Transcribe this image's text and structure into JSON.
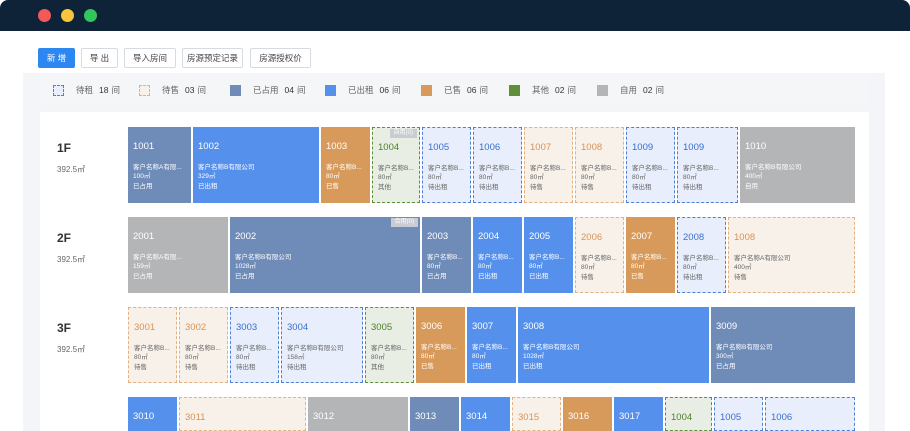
{
  "toolbar": {
    "buttons": [
      "新 增",
      "导 出",
      "导入房间",
      "房源预定记录",
      "房源授权价"
    ]
  },
  "colors": {
    "occupied": "#6f8bb7",
    "rented": "#5590ec",
    "sold": "#d89a5a",
    "other": "#5f8f3a",
    "self_use": "#b4b5b7",
    "wait_rent": "#4e80d8",
    "wait_sale": "#e6b181",
    "primary": "#2d87f0"
  },
  "legend": [
    {
      "label": "待租",
      "count": "18",
      "unit": "间"
    },
    {
      "label": "待售",
      "count": "03",
      "unit": "间"
    },
    {
      "label": "已占用",
      "count": "04",
      "unit": "间"
    },
    {
      "label": "已出租",
      "count": "06",
      "unit": "间"
    },
    {
      "label": "已售",
      "count": "06",
      "unit": "间"
    },
    {
      "label": "其他",
      "count": "02",
      "unit": "间"
    },
    {
      "label": "自用",
      "count": "02",
      "unit": "间"
    }
  ],
  "floors": [
    {
      "name": "1F",
      "area": "392.5㎡",
      "rooms": [
        {
          "num": "1001",
          "company": "客户名称A有限...",
          "area": "100㎡",
          "status": "已占用"
        },
        {
          "num": "1002",
          "company": "客户名称B有限公司",
          "area": "329㎡",
          "status": "已出租"
        },
        {
          "num": "1003",
          "company": "客户名称B...",
          "area": "80㎡",
          "status": "已售"
        },
        {
          "num": "1004",
          "company": "客户名称B...",
          "area": "80㎡",
          "status": "其他",
          "tag": "自用(0)"
        },
        {
          "num": "1005",
          "company": "客户名称B...",
          "area": "80㎡",
          "status": "待出租"
        },
        {
          "num": "1006",
          "company": "客户名称B...",
          "area": "80㎡",
          "status": "待出租"
        },
        {
          "num": "1007",
          "company": "客户名称B...",
          "area": "80㎡",
          "status": "待售"
        },
        {
          "num": "1008",
          "company": "客户名称B...",
          "area": "80㎡",
          "status": "待售"
        },
        {
          "num": "1009",
          "company": "客户名称B...",
          "area": "80㎡",
          "status": "待出租"
        },
        {
          "num": "1009",
          "company": "客户名称B...",
          "area": "80㎡",
          "status": "待出租"
        },
        {
          "num": "1010",
          "company": "客户名称B有限公司",
          "area": "400㎡",
          "status": "自用"
        }
      ]
    },
    {
      "name": "2F",
      "area": "392.5㎡",
      "rooms": [
        {
          "num": "2001",
          "company": "客户名称A有限...",
          "area": "159㎡",
          "status": "已占用"
        },
        {
          "num": "2002",
          "company": "客户名称B有限公司",
          "area": "1028㎡",
          "status": "已占用",
          "tag": "合用(0)"
        },
        {
          "num": "2003",
          "company": "客户名称B...",
          "area": "80㎡",
          "status": "已占用"
        },
        {
          "num": "2004",
          "company": "客户名称B...",
          "area": "80㎡",
          "status": "已出租"
        },
        {
          "num": "2005",
          "company": "客户名称B...",
          "area": "80㎡",
          "status": "已出租"
        },
        {
          "num": "2006",
          "company": "客户名称B...",
          "area": "80㎡",
          "status": "待售"
        },
        {
          "num": "2007",
          "company": "客户名称B...",
          "area": "80㎡",
          "status": "已售"
        },
        {
          "num": "2008",
          "company": "客户名称B...",
          "area": "80㎡",
          "status": "待出租"
        },
        {
          "num": "1008",
          "company": "客户名称A有限公司",
          "area": "400㎡",
          "status": "待售"
        }
      ]
    },
    {
      "name": "3F",
      "area": "392.5㎡",
      "rooms": [
        {
          "num": "3001",
          "company": "客户名称B...",
          "area": "80㎡",
          "status": "待售"
        },
        {
          "num": "3002",
          "company": "客户名称B...",
          "area": "80㎡",
          "status": "待售"
        },
        {
          "num": "3003",
          "company": "客户名称B...",
          "area": "80㎡",
          "status": "待出租"
        },
        {
          "num": "3004",
          "company": "客户名称B有限公司",
          "area": "158㎡",
          "status": "待出租"
        },
        {
          "num": "3005",
          "company": "客户名称B...",
          "area": "80㎡",
          "status": "其他"
        },
        {
          "num": "3006",
          "company": "客户名称B...",
          "area": "80㎡",
          "status": "已售"
        },
        {
          "num": "3007",
          "company": "客户名称B...",
          "area": "80㎡",
          "status": "已出租"
        },
        {
          "num": "3008",
          "company": "客户名称B有限公司",
          "area": "1028㎡",
          "status": "已出租"
        },
        {
          "num": "3009",
          "company": "客户名称B有限公司",
          "area": "300㎡",
          "status": "已占用"
        }
      ]
    },
    {
      "name": "",
      "area": "",
      "rooms": [
        {
          "num": "3010"
        },
        {
          "num": "3011"
        },
        {
          "num": "3012"
        },
        {
          "num": "3013"
        },
        {
          "num": "3014"
        },
        {
          "num": "3015"
        },
        {
          "num": "3016"
        },
        {
          "num": "3017"
        },
        {
          "num": "1004"
        },
        {
          "num": "1005"
        },
        {
          "num": "1006"
        }
      ]
    }
  ]
}
